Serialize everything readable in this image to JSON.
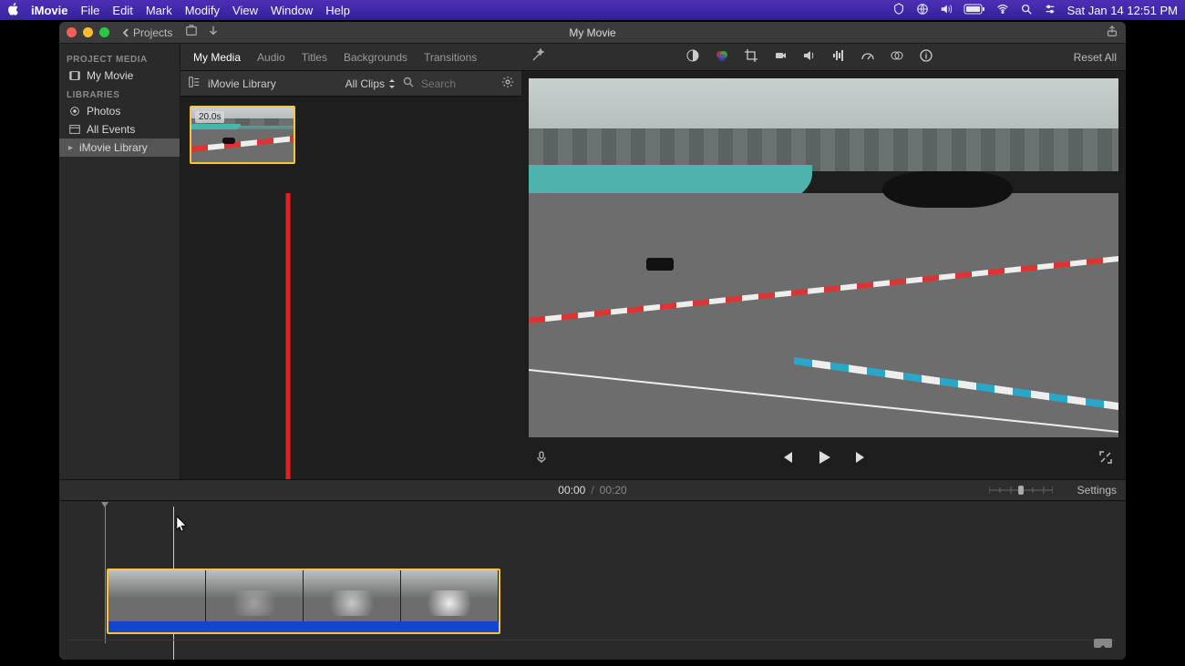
{
  "menubar": {
    "app": "iMovie",
    "items": [
      "File",
      "Edit",
      "Mark",
      "Modify",
      "View",
      "Window",
      "Help"
    ],
    "clock": "Sat Jan 14  12:51 PM"
  },
  "window": {
    "back_label": "Projects",
    "title": "My Movie"
  },
  "sidebar": {
    "section1": "PROJECT MEDIA",
    "project": "My Movie",
    "section2": "LIBRARIES",
    "items": [
      "Photos",
      "All Events",
      "iMovie Library"
    ]
  },
  "tabs": {
    "items": [
      "My Media",
      "Audio",
      "Titles",
      "Backgrounds",
      "Transitions"
    ],
    "active": 0
  },
  "browser_toolbar": {
    "library": "iMovie Library",
    "filter": "All Clips",
    "search_placeholder": "Search"
  },
  "clip": {
    "duration": "20.0s"
  },
  "viewer": {
    "reset": "Reset All"
  },
  "time": {
    "current": "00:00",
    "sep": "/",
    "total": "00:20",
    "settings": "Settings"
  }
}
